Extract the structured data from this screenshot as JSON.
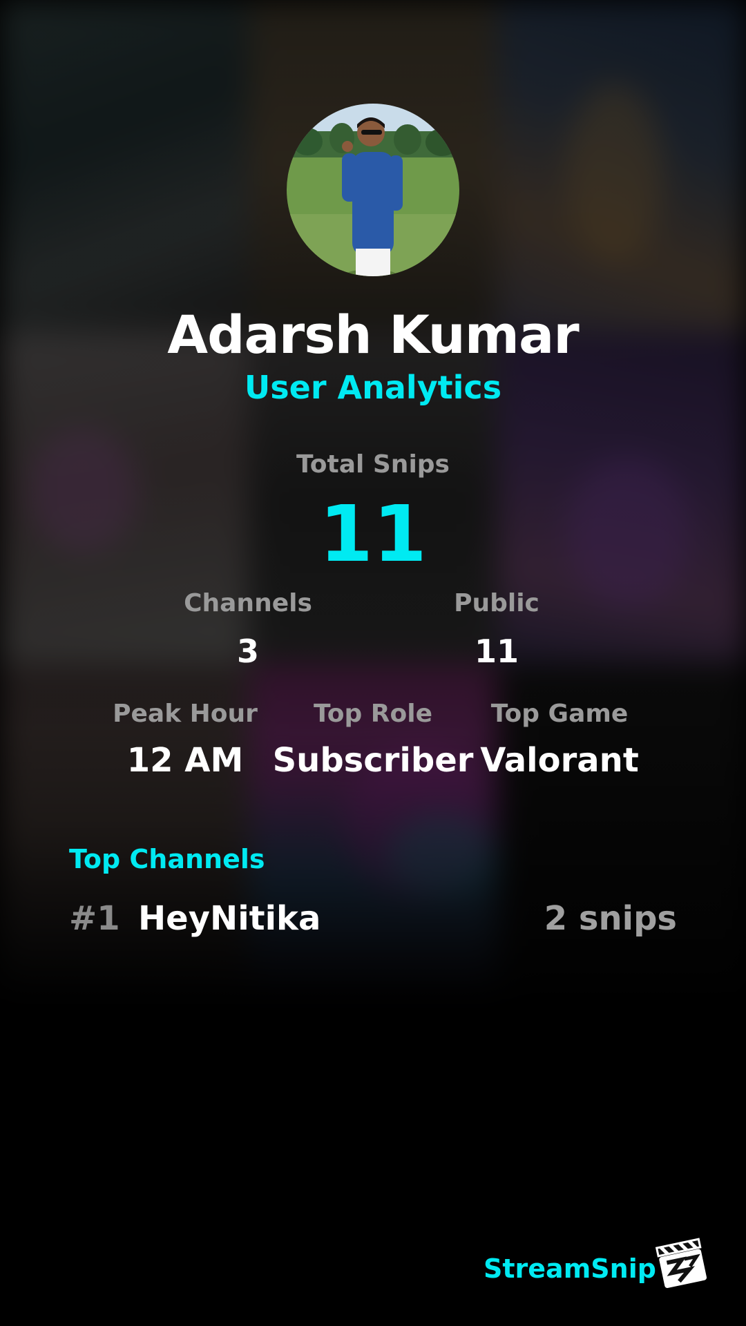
{
  "profile": {
    "name": "Adarsh Kumar",
    "subtitle": "User Analytics"
  },
  "stats": {
    "total_label": "Total Snips",
    "total_value": "11",
    "channels_label": "Channels",
    "channels_value": "3",
    "public_label": "Public",
    "public_value": "11",
    "peak_label": "Peak Hour",
    "peak_value": "12 AM",
    "role_label": "Top Role",
    "role_value": "Subscriber",
    "game_label": "Top Game",
    "game_value": "Valorant"
  },
  "top_channels": {
    "title": "Top Channels",
    "items": [
      {
        "rank": "#1",
        "name": "HeyNitika",
        "count": "2 snips"
      }
    ]
  },
  "brand": {
    "name": "StreamSnip",
    "icon": "clapperboard-icon"
  },
  "colors": {
    "accent": "#00eaf2",
    "muted": "#9a9a9a",
    "background": "#000000"
  }
}
